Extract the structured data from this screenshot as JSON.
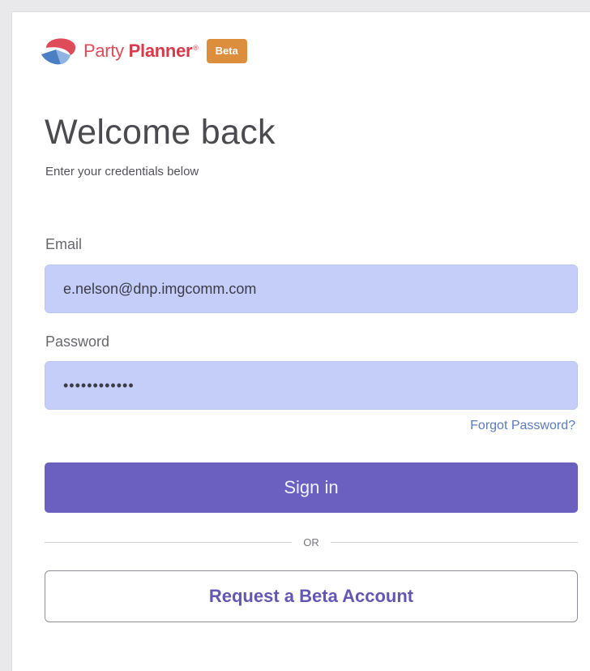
{
  "brand": {
    "logo_icon": "party-planner-logo-icon",
    "name_part1": "Party",
    "name_part2": "Planner",
    "trademark": "®",
    "badge": "Beta",
    "colors": {
      "brand_red": "#e04b5a",
      "logo_blue": "#4a7fc4",
      "badge_orange": "#dd8e3c"
    }
  },
  "login": {
    "title": "Welcome back",
    "subtitle": "Enter your credentials below",
    "email": {
      "label": "Email",
      "value": "e.nelson@dnp.imgcomm.com"
    },
    "password": {
      "label": "Password",
      "value": "••••••••••••"
    },
    "forgot_password": "Forgot Password?",
    "sign_in_label": "Sign in",
    "divider_text": "OR",
    "request_account_label": "Request a Beta Account",
    "colors": {
      "input_fill": "#c4cef8",
      "primary_button": "#6b5fbf",
      "link": "#5d7bbd"
    }
  }
}
